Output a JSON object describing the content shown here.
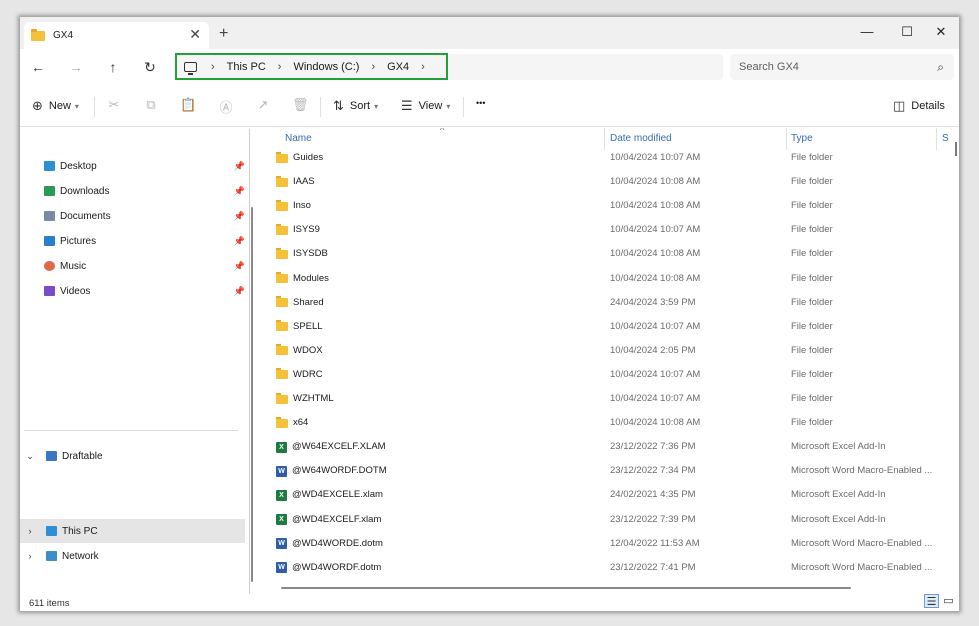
{
  "window": {
    "tab_title": "GX4",
    "new_tab": "+",
    "minimize": "—",
    "maximize": "☐",
    "close": "✕"
  },
  "address": {
    "crumbs": [
      "This PC",
      "Windows (C:)",
      "GX4"
    ],
    "search_placeholder": "Search GX4"
  },
  "commands": {
    "new_label": "New",
    "sort_label": "Sort",
    "view_label": "View",
    "more": "•••",
    "details_label": "Details"
  },
  "sidebar": {
    "quick": [
      {
        "label": "Desktop",
        "icon": "desktop-icon",
        "color": "#2f8fd6"
      },
      {
        "label": "Downloads",
        "icon": "download-icon",
        "color": "#2a9a57"
      },
      {
        "label": "Documents",
        "icon": "documents-icon",
        "color": "#7a8aa3"
      },
      {
        "label": "Pictures",
        "icon": "pictures-icon",
        "color": "#2a7fc9"
      },
      {
        "label": "Music",
        "icon": "music-icon",
        "color": "#e0694a"
      },
      {
        "label": "Videos",
        "icon": "videos-icon",
        "color": "#7a4bc7"
      }
    ],
    "draftable": "Draftable",
    "this_pc": "This PC",
    "network": "Network"
  },
  "columns": {
    "name": "Name",
    "date": "Date modified",
    "type": "Type",
    "size": "S"
  },
  "files": [
    {
      "name": "Guides",
      "date": "10/04/2024 10:07 AM",
      "type": "File folder",
      "kind": "folder"
    },
    {
      "name": "IAAS",
      "date": "10/04/2024 10:08 AM",
      "type": "File folder",
      "kind": "folder"
    },
    {
      "name": "Inso",
      "date": "10/04/2024 10:08 AM",
      "type": "File folder",
      "kind": "folder"
    },
    {
      "name": "ISYS9",
      "date": "10/04/2024 10:07 AM",
      "type": "File folder",
      "kind": "folder"
    },
    {
      "name": "ISYSDB",
      "date": "10/04/2024 10:08 AM",
      "type": "File folder",
      "kind": "folder"
    },
    {
      "name": "Modules",
      "date": "10/04/2024 10:08 AM",
      "type": "File folder",
      "kind": "folder"
    },
    {
      "name": "Shared",
      "date": "24/04/2024 3:59 PM",
      "type": "File folder",
      "kind": "folder"
    },
    {
      "name": "SPELL",
      "date": "10/04/2024 10:07 AM",
      "type": "File folder",
      "kind": "folder"
    },
    {
      "name": "WDOX",
      "date": "10/04/2024 2:05 PM",
      "type": "File folder",
      "kind": "folder"
    },
    {
      "name": "WDRC",
      "date": "10/04/2024 10:07 AM",
      "type": "File folder",
      "kind": "folder"
    },
    {
      "name": "WZHTML",
      "date": "10/04/2024 10:07 AM",
      "type": "File folder",
      "kind": "folder"
    },
    {
      "name": "x64",
      "date": "10/04/2024 10:08 AM",
      "type": "File folder",
      "kind": "folder"
    },
    {
      "name": "@W64EXCELF.XLAM",
      "date": "23/12/2022 7:36 PM",
      "type": "Microsoft Excel Add-In",
      "kind": "excel"
    },
    {
      "name": "@W64WORDF.DOTM",
      "date": "23/12/2022 7:34 PM",
      "type": "Microsoft Word Macro-Enabled ...",
      "kind": "word"
    },
    {
      "name": "@WD4EXCELE.xlam",
      "date": "24/02/2021 4:35 PM",
      "type": "Microsoft Excel Add-In",
      "kind": "excel"
    },
    {
      "name": "@WD4EXCELF.xlam",
      "date": "23/12/2022 7:39 PM",
      "type": "Microsoft Excel Add-In",
      "kind": "excel"
    },
    {
      "name": "@WD4WORDE.dotm",
      "date": "12/04/2022 11:53 AM",
      "type": "Microsoft Word Macro-Enabled ...",
      "kind": "word"
    },
    {
      "name": "@WD4WORDF.dotm",
      "date": "23/12/2022 7:41 PM",
      "type": "Microsoft Word Macro-Enabled ...",
      "kind": "word"
    }
  ],
  "status": {
    "count": "611 items"
  }
}
